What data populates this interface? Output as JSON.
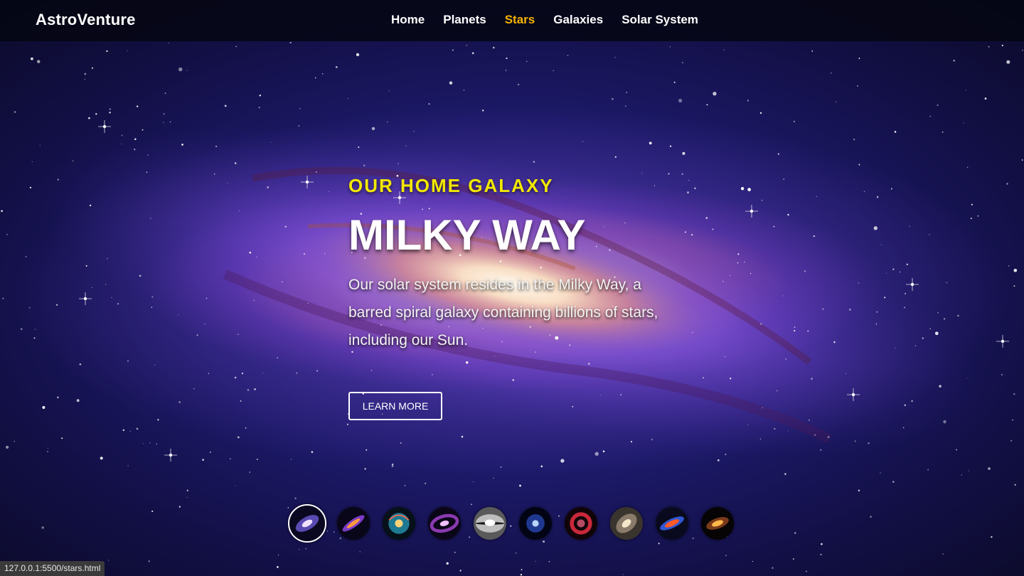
{
  "header": {
    "brand": "AstroVenture",
    "nav": [
      {
        "label": "Home",
        "active": false
      },
      {
        "label": "Planets",
        "active": false
      },
      {
        "label": "Stars",
        "active": true
      },
      {
        "label": "Galaxies",
        "active": false
      },
      {
        "label": "Solar System",
        "active": false
      }
    ]
  },
  "hero": {
    "kicker": "OUR HOME GALAXY",
    "title": "MILKY WAY",
    "description": "Our solar system resides in the Milky Way, a barred spiral galaxy containing billions of stars, including our Sun.",
    "button_label": "LEARN MORE"
  },
  "gallery": {
    "selected_index": 0,
    "thumbnails": [
      {
        "icon": "spiral-galaxy-icon",
        "colors": [
          "#d9c2ff",
          "#6b5bd6"
        ]
      },
      {
        "icon": "edge-galaxy-icon",
        "colors": [
          "#ff9a3c",
          "#7a3cc8"
        ]
      },
      {
        "icon": "spiral-galaxy-icon",
        "colors": [
          "#ffd27a",
          "#2aa6c8"
        ]
      },
      {
        "icon": "ring-galaxy-icon",
        "colors": [
          "#f0c0ff",
          "#8a3ab0"
        ]
      },
      {
        "icon": "sombrero-galaxy-icon",
        "colors": [
          "#ffffff",
          "#8a8a8a"
        ]
      },
      {
        "icon": "spiral-galaxy-icon",
        "colors": [
          "#b8d4ff",
          "#2a4ab8"
        ]
      },
      {
        "icon": "nebula-galaxy-icon",
        "colors": [
          "#ff6a8a",
          "#c8283a"
        ]
      },
      {
        "icon": "elliptical-galaxy-icon",
        "colors": [
          "#f4e6c8",
          "#8a7a6a"
        ]
      },
      {
        "icon": "starburst-galaxy-icon",
        "colors": [
          "#ff5a2a",
          "#3a6aff"
        ]
      },
      {
        "icon": "edge-galaxy-icon",
        "colors": [
          "#ffb84a",
          "#7a3a1a"
        ]
      }
    ]
  },
  "status_bar": {
    "url": "127.0.0.1:5500/stars.html"
  },
  "theme": {
    "active_nav": "#f5b301",
    "kicker": "#f2e800",
    "background": "#0b0b2e"
  }
}
